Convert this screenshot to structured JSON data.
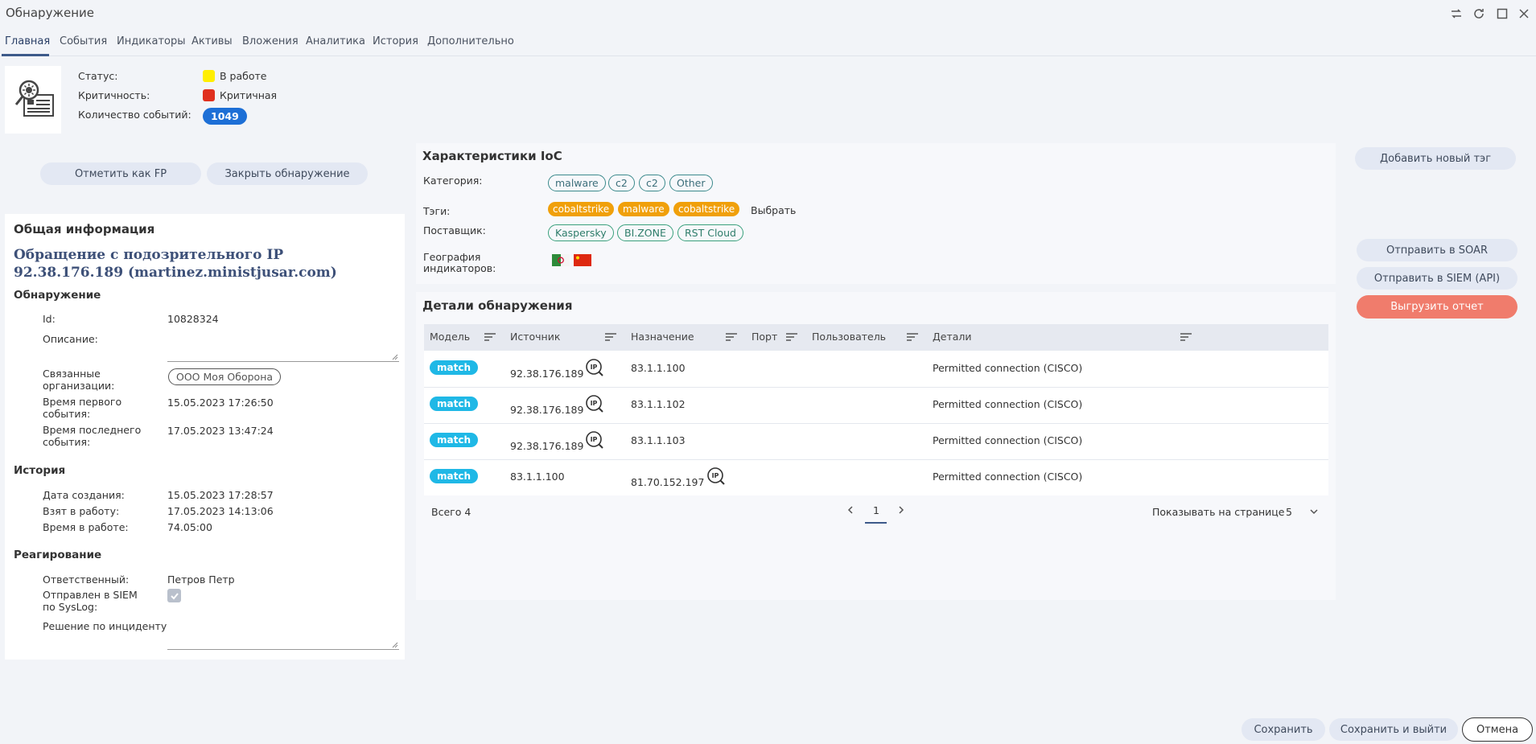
{
  "window": {
    "title": "Обнаружение"
  },
  "tabs": [
    {
      "label": "Главная"
    },
    {
      "label": "События"
    },
    {
      "label": "Индикаторы"
    },
    {
      "label": "Активы"
    },
    {
      "label": "Вложения"
    },
    {
      "label": "Аналитика"
    },
    {
      "label": "История"
    },
    {
      "label": "Дополнительно"
    }
  ],
  "summary": {
    "status_label": "Статус:",
    "status_value": "В работе",
    "status_color": "#ffee00",
    "criticality_label": "Критичность:",
    "criticality_value": "Критичная",
    "criticality_color": "#e0301e",
    "events_label": "Количество событий:",
    "events_count": "1049"
  },
  "actions": {
    "mark_fp": "Отметить как FP",
    "close_detection": "Закрыть обнаружение"
  },
  "general": {
    "section_title": "Общая информация",
    "headline": "Обращение с подозрительного IP 92.38.176.189 (martinez.ministjusar.com)",
    "detection_title": "Обнаружение",
    "id_label": "Id:",
    "id_value": "10828324",
    "description_label": "Описание:",
    "related_orgs_label": "Связанные организации:",
    "related_org": "ООО Моя Оборона",
    "first_event_label": "Время первого события:",
    "first_event_value": "15.05.2023 17:26:50",
    "last_event_label": "Время последнего события:",
    "last_event_value": "17.05.2023 13:47:24",
    "history_title": "История",
    "created_label": "Дата создания:",
    "created_value": "15.05.2023 17:28:57",
    "taken_label": "Взят в работу:",
    "taken_value": "17.05.2023 14:13:06",
    "inwork_label": "Время в работе:",
    "inwork_value": "74.05:00",
    "response_title": "Реагирование",
    "responsible_label": "Ответственный:",
    "responsible_value": "Петров Петр",
    "siem_label": "Отправлен в SIEM по SysLog:",
    "decision_label": "Решение по инциденту:"
  },
  "ioc": {
    "title": "Характеристики IoC",
    "category_label": "Категория:",
    "categories": [
      "malware",
      "c2",
      "c2",
      "Other"
    ],
    "tags_label": "Тэги:",
    "tags": [
      "cobaltstrike",
      "malware",
      "cobaltstrike"
    ],
    "choose": "Выбрать",
    "providers_label": "Поставщик:",
    "providers": [
      "Kaspersky",
      "BI.ZONE",
      "RST Cloud"
    ],
    "geo_label": "География индикаторов:"
  },
  "details": {
    "title": "Детали обнаружения",
    "columns": {
      "model": "Модель",
      "source": "Источник",
      "destination": "Назначение",
      "port": "Порт",
      "user": "Пользователь",
      "details": "Детали"
    },
    "rows": [
      {
        "model": "match",
        "source": "92.38.176.189",
        "destination": "83.1.1.100",
        "port": "",
        "user": "",
        "details": "Permitted connection (CISCO)"
      },
      {
        "model": "match",
        "source": "92.38.176.189",
        "destination": "83.1.1.102",
        "port": "",
        "user": "",
        "details": "Permitted connection (CISCO)"
      },
      {
        "model": "match",
        "source": "92.38.176.189",
        "destination": "83.1.1.103",
        "port": "",
        "user": "",
        "details": "Permitted connection (CISCO)"
      },
      {
        "model": "match",
        "source": "83.1.1.100",
        "destination": "81.70.152.197",
        "port": "",
        "user": "",
        "details": "Permitted connection (CISCO)"
      }
    ],
    "total": "Всего 4",
    "page": "1",
    "per_page_label": "Показывать на странице",
    "per_page_value": "5"
  },
  "right_actions": {
    "add_tag": "Добавить новый тэг",
    "send_soar": "Отправить в SOAR",
    "send_siem": "Отправить в SIEM (API)",
    "export_report": "Выгрузить отчет"
  },
  "footer": {
    "save": "Сохранить",
    "save_exit": "Сохранить и выйти",
    "cancel": "Отмена"
  },
  "colors": {
    "accent": "#3d5a8a",
    "match_badge": "#1fb8e6",
    "tag_orange": "#f0a00a",
    "export_button": "#f07c6c"
  },
  "icons": [
    "detection-app-icon",
    "maximize-icon",
    "refresh-icon",
    "restore-icon",
    "sort-icon",
    "ip-lookup-icon",
    "chevron-left-icon",
    "chevron-right-icon",
    "chevron-down-icon",
    "checkbox-icon",
    "flag-algeria-icon",
    "flag-china-icon"
  ]
}
